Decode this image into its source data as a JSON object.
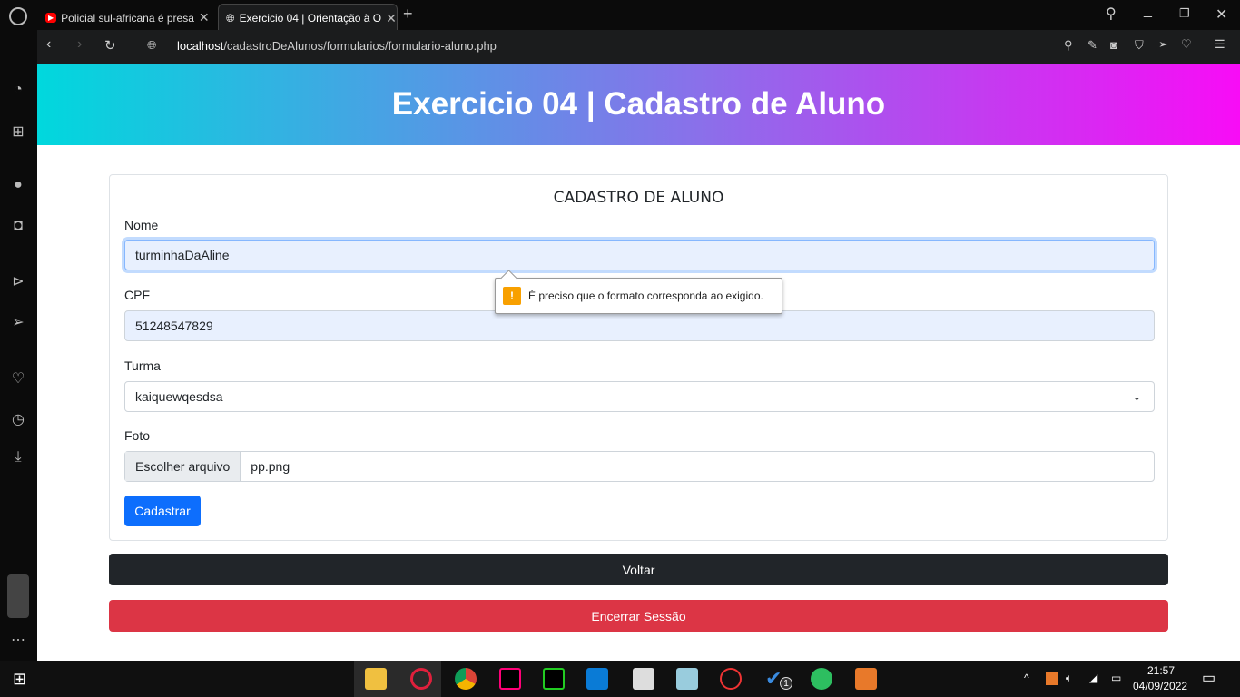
{
  "browser": {
    "tabs": [
      {
        "title": "Policial sul-africana é presa",
        "icon": "youtube-icon"
      },
      {
        "title": "Exercicio 04 | Orientação à O",
        "icon": "globe-icon"
      }
    ],
    "url_host": "localhost",
    "url_path": "/cadastroDeAlunos/formularios/formulario-aluno.php"
  },
  "page": {
    "header": "Exercicio 04 | Cadastro de Aluno",
    "card_title": "CADASTRO DE ALUNO",
    "fields": {
      "nome_label": "Nome",
      "nome_value": "turminhaDaAline",
      "cpf_label": "CPF",
      "cpf_value": "51248547829",
      "turma_label": "Turma",
      "turma_value": "kaiquewqesdsa",
      "foto_label": "Foto",
      "foto_button": "Escolher arquivo",
      "foto_value": "pp.png"
    },
    "validation_message": "É preciso que o formato corresponda ao exigido.",
    "submit": "Cadastrar",
    "back": "Voltar",
    "logout": "Encerrar Sessão"
  },
  "colors": {
    "primary": "#0d6efd",
    "dark": "#212529",
    "danger": "#dc3545",
    "gradient_start": "#00d8dd",
    "gradient_end": "#f80cf6"
  },
  "taskbar": {
    "time": "21:57",
    "date": "04/09/2022",
    "badge": "1"
  }
}
